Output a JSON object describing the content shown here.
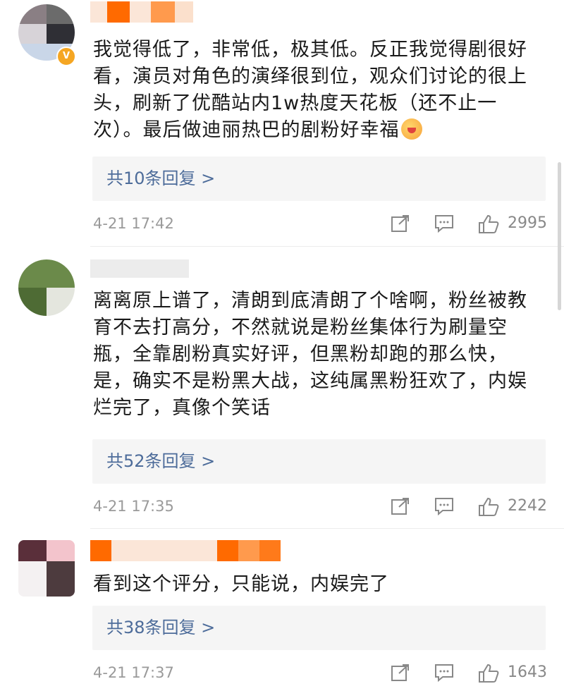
{
  "comments": [
    {
      "username": "",
      "verified_badge": "V",
      "body": "我觉得低了，非常低，极其低。反正我觉得剧很好看，演员对角色的演绎很到位，观众们讨论的很上头，刷新了优酷站内1w热度天花板（还不止一次）。最后做迪丽热巴的剧粉好幸福",
      "emoji": "blushing-face-emoji",
      "replies_label": "共10条回复 >",
      "time": "4-21 17:42",
      "likes": "2995"
    },
    {
      "username": "",
      "body": "离离原上谱了，清朗到底清朗了个啥啊，粉丝被教育不去打高分，不然就说是粉丝集体行为刷量空瓶，全靠剧粉真实好评，但黑粉却跑的那么快，是，确实不是粉黑大战，这纯属黑粉狂欢了，内娱烂完了，真像个笑话",
      "replies_label": "共52条回复 >",
      "time": "4-21 17:35",
      "likes": "2242"
    },
    {
      "username": "",
      "body": "看到这个评分，只能说，内娱完了",
      "replies_label": "共38条回复 >",
      "time": "4-21 17:37",
      "likes": "1643"
    }
  ],
  "icons": {
    "share": "share-icon",
    "comment": "comment-icon",
    "like": "thumbs-up-icon"
  },
  "colors": {
    "reply_link": "#4d6c9a",
    "meta_gray": "#9a9a9a",
    "reply_bg": "#f5f5f5",
    "verified": "#f5a623"
  }
}
